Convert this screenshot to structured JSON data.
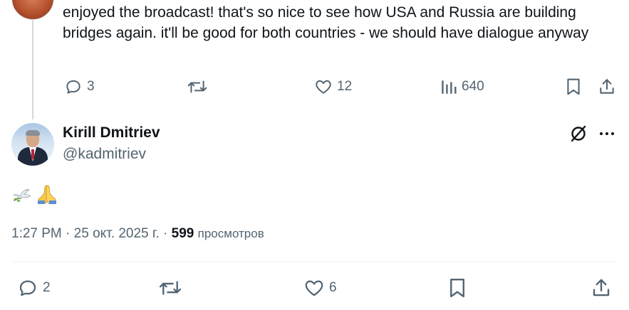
{
  "parent_reply": {
    "text": "enjoyed the broadcast! that's so nice to see how USA and Russia are building bridges again. it'll be good for both countries - we should have dialogue anyway",
    "actions": {
      "replies": "3",
      "likes": "12",
      "views": "640"
    }
  },
  "tweet": {
    "author_name": "Kirill Dmitriev",
    "author_handle": "@kadmitriev",
    "emojis": [
      "dove-icon",
      "folded-hands-icon"
    ],
    "time": "1:27 PM",
    "date": "25 окт. 2025 г.",
    "separator": " · ",
    "views_count": "599",
    "views_label": "просмотров",
    "actions": {
      "replies": "2",
      "likes": "6"
    }
  },
  "colors": {
    "text": "#0f1419",
    "secondary": "#536471",
    "divider": "#eff3f4",
    "thread_line": "#cfd9de"
  }
}
